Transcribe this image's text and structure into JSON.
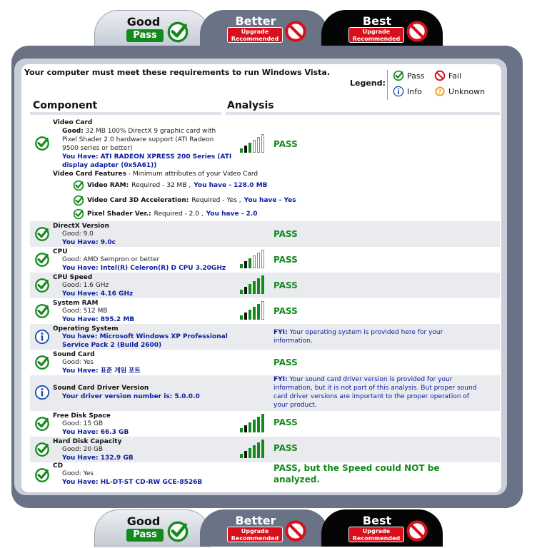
{
  "tabs": {
    "good": {
      "title": "Good",
      "badge": "Pass"
    },
    "better": {
      "title": "Better",
      "badge_line1": "Upgrade",
      "badge_line2": "Recommended"
    },
    "best": {
      "title": "Best",
      "badge_line1": "Upgrade",
      "badge_line2": "Recommended"
    }
  },
  "requirements_text": "Your computer must meet these requirements to run Windows Vista.",
  "legend": {
    "title": "Legend:",
    "pass": "Pass",
    "fail": "Fail",
    "info": "Info",
    "unknown": "Unknown"
  },
  "columns": {
    "component": "Component",
    "analysis": "Analysis"
  },
  "colors": {
    "pass_green": "#138a1c",
    "fail_red": "#d7101c",
    "info_blue": "#1a4fb0",
    "unknown_orange": "#f0a020",
    "have_blue": "#0a1ea0"
  },
  "rows": {
    "video_card": {
      "name": "Video Card",
      "good_label": "Good:",
      "good_line1": "32 MB 100% DirectX 9 graphic card with",
      "good_line2": "Pixel Shader 2.0 hardware support (ATI Radeon",
      "good_line3": "9500 series or better)",
      "have_line1": "You Have: ATI RADEON XPRESS 200 Series (ATI",
      "have_line2": "display adapter (0x5A61))",
      "bars": 3,
      "result": "PASS",
      "features_title": "Video Card Features",
      "features_desc": " - Minimum attributes of your Video Card",
      "features": [
        {
          "label": "Video RAM:",
          "req": "Required - 32 MB ,",
          "have": "You have - 128.0 MB"
        },
        {
          "label": "Video Card 3D Acceleration:",
          "req": "Required - Yes ,",
          "have": "You have - Yes"
        },
        {
          "label": "Pixel Shader Ver.:",
          "req": "Required - 2.0 ,",
          "have": "You have - 2.0"
        }
      ]
    },
    "directx": {
      "name": "DirectX Version",
      "good": "Good: 9.0",
      "have": "You Have: 9.0c",
      "result": "PASS"
    },
    "cpu": {
      "name": "CPU",
      "good": "Good: AMD Sempron or better",
      "have": "You Have: Intel(R) Celeron(R) D CPU 3.20GHz",
      "bars": 3,
      "result": "PASS"
    },
    "cpu_speed": {
      "name": "CPU Speed",
      "good": "Good: 1.6 GHz",
      "have": "You Have: 4.16 GHz",
      "bars": 6,
      "result": "PASS"
    },
    "system_ram": {
      "name": "System RAM",
      "good": "Good: 512 MB",
      "have": "You Have: 895.2 MB",
      "bars": 5,
      "result": "PASS"
    },
    "os": {
      "name": "Operating System",
      "have_line1": "You have: Microsoft Windows XP Professional",
      "have_line2": "Service Pack 2 (Build 2600)",
      "fyi_label": "FYI:",
      "fyi_line1": " Your operating system is provided here for your",
      "fyi_line2": "information."
    },
    "sound_card": {
      "name": "Sound Card",
      "good": "Good: Yes",
      "have": "You Have: 표준 게임 포트",
      "result": "PASS"
    },
    "sound_driver": {
      "name": "Sound Card Driver Version",
      "have": "Your driver version number is: 5.0.0.0",
      "fyi_label": "FYI:",
      "fyi_line1": " Your sound card driver version is provided for your",
      "fyi_line2": "information, but it is not part of this analysis. But proper sound",
      "fyi_line3": "card driver versions are important to the proper operation of",
      "fyi_line4": "your product."
    },
    "free_disk": {
      "name": "Free Disk Space",
      "good": "Good: 15 GB",
      "have": "You Have: 66.3 GB",
      "bars": 6,
      "result": "PASS"
    },
    "hard_disk": {
      "name": "Hard Disk Capacity",
      "good": "Good: 20 GB",
      "have": "You Have: 132.9 GB",
      "bars": 6,
      "result": "PASS"
    },
    "cd": {
      "name": "CD",
      "good": "Good: Yes",
      "have": "You Have: HL-DT-ST CD-RW GCE-8526B",
      "result_line1": "PASS, but the Speed could NOT be",
      "result_line2": "analyzed."
    }
  }
}
